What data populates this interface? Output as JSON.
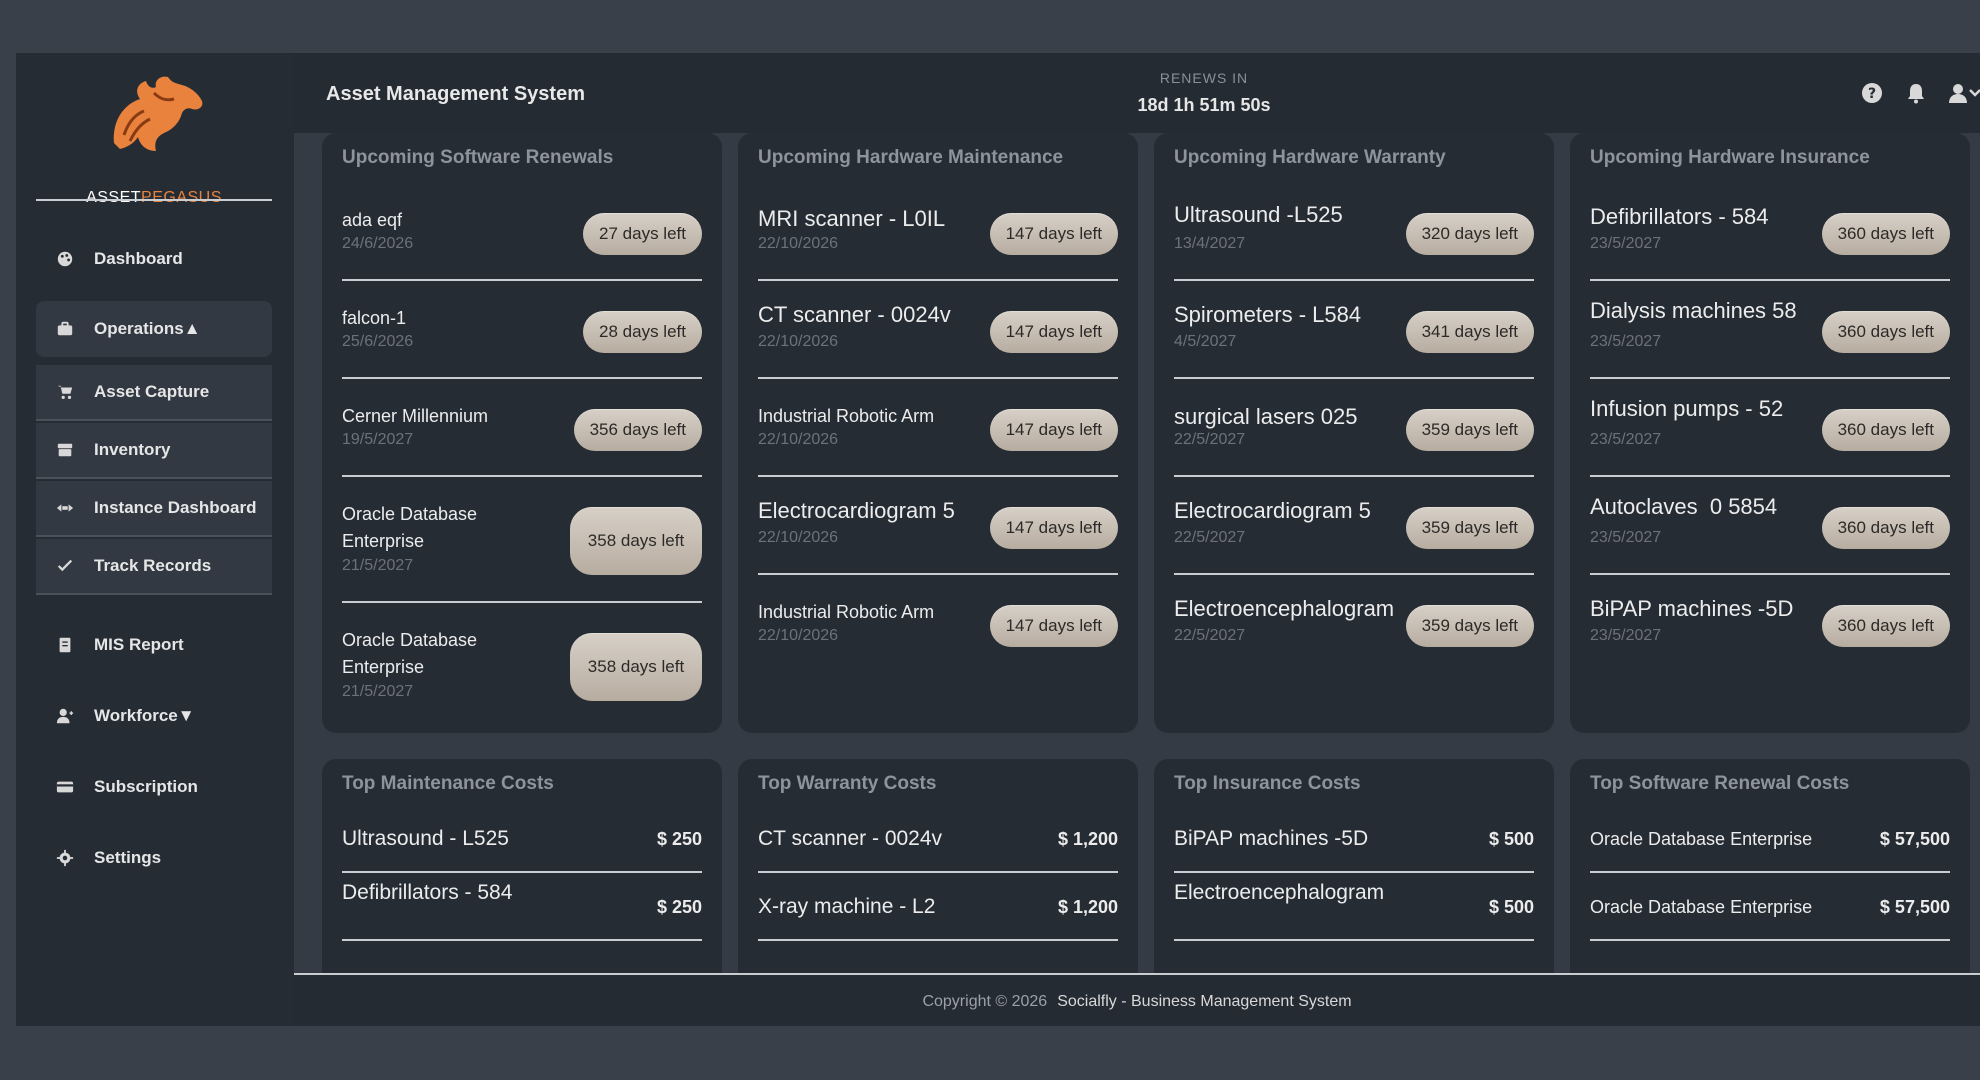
{
  "brand": {
    "part1": "ASSET",
    "part2": "PEGASUS"
  },
  "header": {
    "title": "Asset Management System",
    "renew_label": "RENEWS IN",
    "renew_time": "18d 1h 51m 50s"
  },
  "icons": {
    "help": "help-icon",
    "bell": "bell-icon",
    "user": "user-icon"
  },
  "sidebar": {
    "items": [
      {
        "label": "Dashboard",
        "icon": "palette-icon"
      },
      {
        "label": "Operations▲",
        "icon": "briefcase-icon"
      },
      {
        "label": "Asset Capture",
        "icon": "cart-icon"
      },
      {
        "label": "Inventory",
        "icon": "archive-icon"
      },
      {
        "label": "Instance Dashboard",
        "icon": "arrows-icon"
      },
      {
        "label": "Track Records",
        "icon": "check-icon"
      },
      {
        "label": "MIS Report",
        "icon": "file-icon"
      },
      {
        "label": "Workforce▼",
        "icon": "user-plus-icon"
      },
      {
        "label": "Subscription",
        "icon": "card-icon"
      },
      {
        "label": "Settings",
        "icon": "gear-icon"
      }
    ]
  },
  "upcoming": [
    {
      "title": "Upcoming Software Renewals",
      "rows": [
        {
          "name": "ada eqf",
          "date": "24/6/2026",
          "days": "27 days left"
        },
        {
          "name": "falcon-1",
          "date": "25/6/2026",
          "days": "28 days left"
        },
        {
          "name": "Cerner Millennium",
          "date": "19/5/2027",
          "days": "356 days left"
        },
        {
          "name": "Oracle Database Enterprise",
          "date": "21/5/2027",
          "days": "358 days left"
        },
        {
          "name": "Oracle Database Enterprise",
          "date": "21/5/2027",
          "days": "358 days left"
        }
      ]
    },
    {
      "title": "Upcoming Hardware Maintenance",
      "rows": [
        {
          "name": "MRI scanner - L0IL",
          "date": "22/10/2026",
          "days": "147 days left"
        },
        {
          "name": "CT scanner - 0024v",
          "date": "22/10/2026",
          "days": "147 days left"
        },
        {
          "name": "Industrial Robotic Arm",
          "date": "22/10/2026",
          "days": "147 days left"
        },
        {
          "name": "Electrocardiogram 5",
          "date": "22/10/2026",
          "days": "147 days left"
        },
        {
          "name": "Industrial Robotic Arm",
          "date": "22/10/2026",
          "days": "147 days left"
        }
      ]
    },
    {
      "title": "Upcoming Hardware Warranty",
      "rows": [
        {
          "name": "Ultrasound -L525",
          "date": "13/4/2027",
          "days": "320 days left"
        },
        {
          "name": "Spirometers - L584",
          "date": "4/5/2027",
          "days": "341 days left"
        },
        {
          "name": "surgical lasers 025",
          "date": "22/5/2027",
          "days": "359 days left"
        },
        {
          "name": "Electrocardiogram 5",
          "date": "22/5/2027",
          "days": "359 days left"
        },
        {
          "name": "Electroencephalogram",
          "date": "22/5/2027",
          "days": "359 days left"
        }
      ]
    },
    {
      "title": "Upcoming Hardware Insurance",
      "rows": [
        {
          "name": "Defibrillators - 584",
          "date": "23/5/2027",
          "days": "360 days left"
        },
        {
          "name": "Dialysis machines 58",
          "date": "23/5/2027",
          "days": "360 days left"
        },
        {
          "name": "Infusion pumps - 52",
          "date": "23/5/2027",
          "days": "360 days left"
        },
        {
          "name": "Autoclaves  0 5854",
          "date": "23/5/2027",
          "days": "360 days left"
        },
        {
          "name": "BiPAP machines -5D",
          "date": "23/5/2027",
          "days": "360 days left"
        }
      ]
    }
  ],
  "costs": [
    {
      "title": "Top Maintenance Costs",
      "rows": [
        {
          "name": "Ultrasound - L525",
          "value": "$ 250"
        },
        {
          "name": "Defibrillators - 584",
          "value": "$ 250"
        }
      ]
    },
    {
      "title": "Top Warranty Costs",
      "rows": [
        {
          "name": "CT scanner - 0024v",
          "value": "$ 1,200"
        },
        {
          "name": "X-ray machine - L2",
          "value": "$ 1,200"
        }
      ]
    },
    {
      "title": "Top Insurance Costs",
      "rows": [
        {
          "name": "BiPAP machines -5D",
          "value": "$ 500"
        },
        {
          "name": "Electroencephalogram",
          "value": "$ 500"
        }
      ]
    },
    {
      "title": "Top Software Renewal Costs",
      "rows": [
        {
          "name": "Oracle Database Enterprise",
          "value": "$ 57,500"
        },
        {
          "name": "Oracle Database Enterprise",
          "value": "$ 57,500"
        }
      ]
    }
  ],
  "footer": {
    "copyright": "Copyright © 2026",
    "brandname": "Socialfly - Business Management System"
  }
}
